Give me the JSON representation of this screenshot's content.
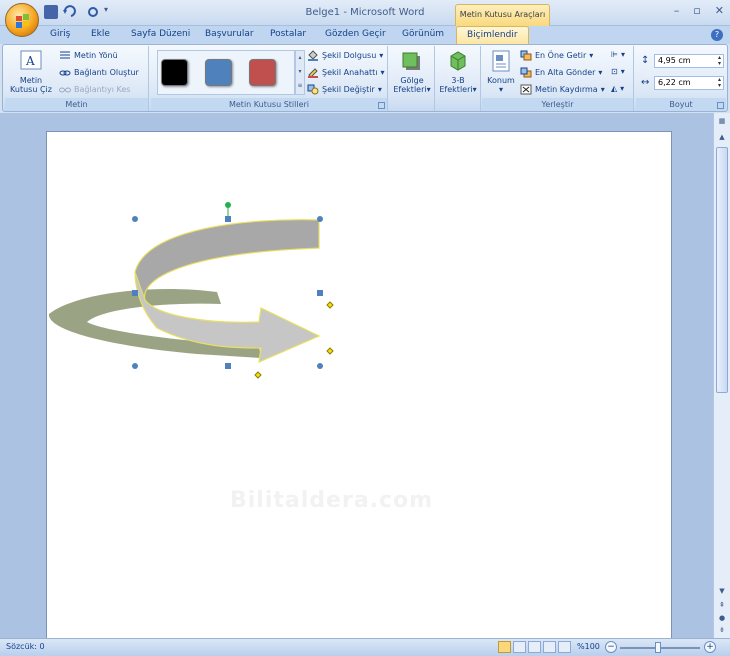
{
  "window": {
    "title": "Belge1 - Microsoft Word",
    "contextual_tab_title": "Metin Kutusu Araçları"
  },
  "tabs": [
    {
      "label": "Giriş"
    },
    {
      "label": "Ekle"
    },
    {
      "label": "Sayfa Düzeni"
    },
    {
      "label": "Başvurular"
    },
    {
      "label": "Postalar"
    },
    {
      "label": "Gözden Geçir"
    },
    {
      "label": "Görünüm"
    },
    {
      "label": "Biçimlendir",
      "active": true
    }
  ],
  "ribbon": {
    "metin": {
      "label": "Metin",
      "draw_text_box": [
        "Metin",
        "Kutusu Çiz"
      ],
      "text_direction": "Metin Yönü",
      "create_link": "Bağlantı Oluştur",
      "break_link": "Bağlantıyı Kes"
    },
    "styles": {
      "label": "Metin Kutusu Stilleri",
      "swatches": [
        "#000000",
        "#4f81bd",
        "#c0504d"
      ],
      "shape_fill": "Şekil Dolgusu",
      "shape_outline": "Şekil Anahattı",
      "change_shape": "Şekil Değiştir"
    },
    "shadow": {
      "label": [
        "Gölge",
        "Efektleri"
      ]
    },
    "threed": {
      "label": [
        "3-B",
        "Efektleri"
      ]
    },
    "arrange": {
      "label": "Yerleştir",
      "position": "Konum",
      "bring_front": "En Öne Getir",
      "send_back": "En Alta Gönder",
      "text_wrap": "Metin Kaydırma"
    },
    "size": {
      "label": "Boyut",
      "height": "4,95 cm",
      "width": "6,22 cm"
    }
  },
  "document": {
    "watermark": "Bilitaldera.com"
  },
  "statusbar": {
    "words": "Sözcük: 0",
    "zoom": "%100"
  },
  "colors": {
    "arrow_dark": "#8f9a77",
    "arrow_light": "#c6c6c6",
    "arrow_outline": "#e8e060",
    "handle": "#4f81bd",
    "rotate_handle": "#22b14c",
    "adjust_handle": "#f5e20a"
  }
}
